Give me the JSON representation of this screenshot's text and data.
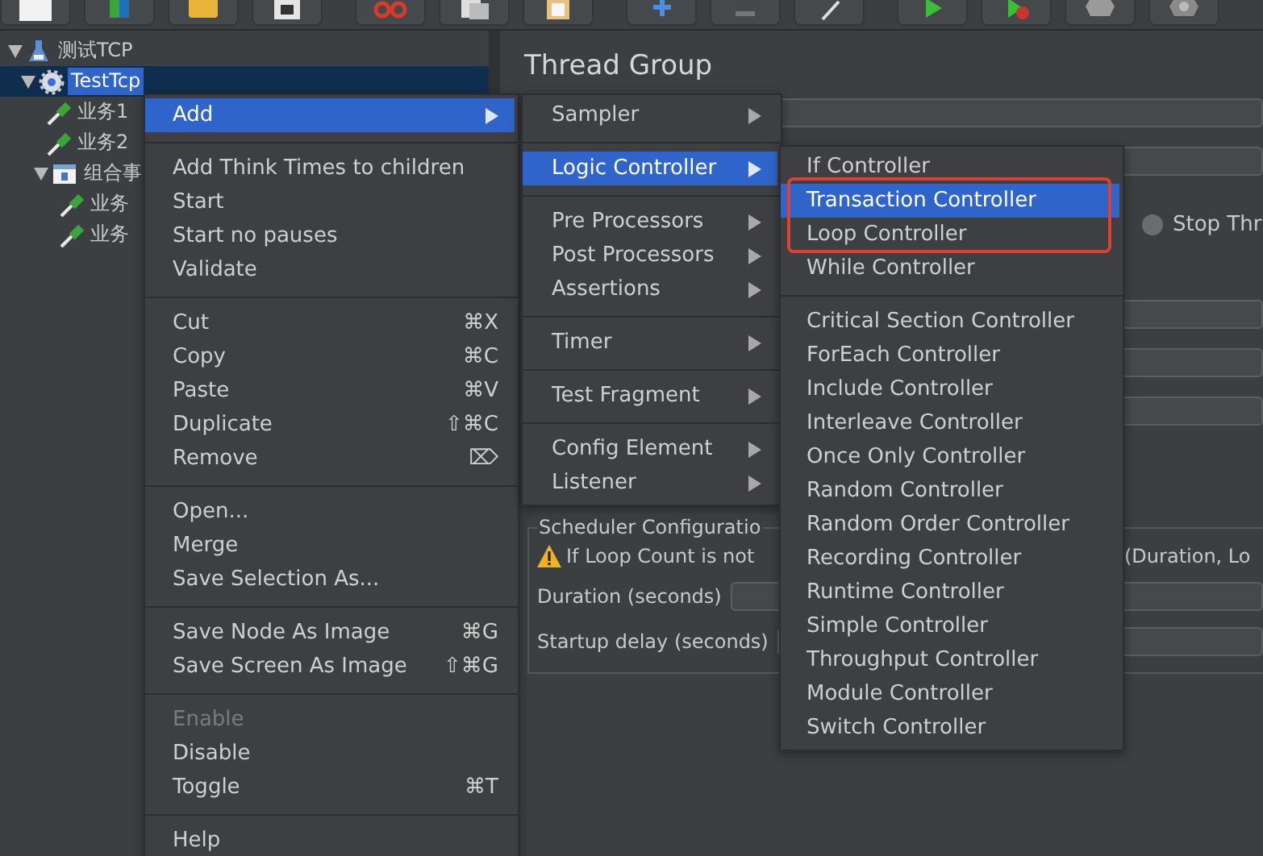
{
  "tree": [
    {
      "label": "测试TCP",
      "kind": "plan",
      "selected": false,
      "expanded": true,
      "children": [
        {
          "label": "TestTcp",
          "kind": "group",
          "selected": true,
          "expanded": true,
          "children": [
            {
              "label": "业务1",
              "kind": "sampler",
              "selected": false
            },
            {
              "label": "业务2",
              "kind": "sampler",
              "selected": false
            },
            {
              "label": "组合事",
              "kind": "controller",
              "selected": false,
              "expanded": true,
              "children": [
                {
                  "label": "业务",
                  "kind": "sampler",
                  "selected": false
                },
                {
                  "label": "业务",
                  "kind": "sampler",
                  "selected": false
                }
              ]
            }
          ]
        }
      ]
    }
  ],
  "panel": {
    "title": "Thread Group",
    "radio": {
      "label": "Stop Thr",
      "selected": false
    },
    "scheduler": {
      "title": "Scheduler Configuratio",
      "warning": "If Loop Count is not",
      "warning_tail": "(Duration, Lo",
      "fields": [
        {
          "label": "Duration (seconds)"
        },
        {
          "label": "Startup delay (seconds)"
        }
      ]
    }
  },
  "context_menu": {
    "sections": [
      {
        "items": [
          {
            "label": "Add",
            "submenu": true,
            "selected": true,
            "disabled": false
          }
        ]
      },
      {
        "items": [
          {
            "label": "Add Think Times to children",
            "submenu": false,
            "selected": false,
            "disabled": false
          },
          {
            "label": "Start",
            "submenu": false,
            "selected": false,
            "disabled": false
          },
          {
            "label": "Start no pauses",
            "submenu": false,
            "selected": false,
            "disabled": false
          },
          {
            "label": "Validate",
            "submenu": false,
            "selected": false,
            "disabled": false
          }
        ]
      },
      {
        "items": [
          {
            "label": "Cut",
            "shortcut": "⌘X",
            "submenu": false,
            "selected": false,
            "disabled": false
          },
          {
            "label": "Copy",
            "shortcut": "⌘C",
            "submenu": false,
            "selected": false,
            "disabled": false
          },
          {
            "label": "Paste",
            "shortcut": "⌘V",
            "submenu": false,
            "selected": false,
            "disabled": false
          },
          {
            "label": "Duplicate",
            "shortcut": "⇧⌘C",
            "submenu": false,
            "selected": false,
            "disabled": false
          },
          {
            "label": "Remove",
            "shortcut": "⌦",
            "submenu": false,
            "selected": false,
            "disabled": false
          }
        ]
      },
      {
        "items": [
          {
            "label": "Open...",
            "submenu": false,
            "selected": false,
            "disabled": false
          },
          {
            "label": "Merge",
            "submenu": false,
            "selected": false,
            "disabled": false
          },
          {
            "label": "Save Selection As...",
            "submenu": false,
            "selected": false,
            "disabled": false
          }
        ]
      },
      {
        "items": [
          {
            "label": "Save Node As Image",
            "shortcut": "⌘G",
            "submenu": false,
            "selected": false,
            "disabled": false
          },
          {
            "label": "Save Screen As Image",
            "shortcut": "⇧⌘G",
            "submenu": false,
            "selected": false,
            "disabled": false
          }
        ]
      },
      {
        "items": [
          {
            "label": "Enable",
            "submenu": false,
            "selected": false,
            "disabled": true
          },
          {
            "label": "Disable",
            "submenu": false,
            "selected": false,
            "disabled": false
          },
          {
            "label": "Toggle",
            "shortcut": "⌘T",
            "submenu": false,
            "selected": false,
            "disabled": false
          }
        ]
      },
      {
        "items": [
          {
            "label": "Help",
            "submenu": false,
            "selected": false,
            "disabled": false
          }
        ]
      }
    ]
  },
  "add_menu": {
    "sections": [
      {
        "items": [
          {
            "label": "Sampler",
            "submenu": true,
            "selected": false
          }
        ]
      },
      {
        "items": [
          {
            "label": "Logic Controller",
            "submenu": true,
            "selected": true
          }
        ]
      },
      {
        "items": [
          {
            "label": "Pre Processors",
            "submenu": true,
            "selected": false
          },
          {
            "label": "Post Processors",
            "submenu": true,
            "selected": false
          },
          {
            "label": "Assertions",
            "submenu": true,
            "selected": false
          }
        ]
      },
      {
        "items": [
          {
            "label": "Timer",
            "submenu": true,
            "selected": false
          }
        ]
      },
      {
        "items": [
          {
            "label": "Test Fragment",
            "submenu": true,
            "selected": false
          }
        ]
      },
      {
        "items": [
          {
            "label": "Config Element",
            "submenu": true,
            "selected": false
          },
          {
            "label": "Listener",
            "submenu": true,
            "selected": false
          }
        ]
      }
    ]
  },
  "controller_menu": {
    "sections": [
      {
        "items": [
          {
            "label": "If Controller",
            "selected": false,
            "outlined": false
          },
          {
            "label": "Transaction Controller",
            "selected": true,
            "outlined": true
          },
          {
            "label": "Loop Controller",
            "selected": false,
            "outlined": true
          },
          {
            "label": "While Controller",
            "selected": false,
            "outlined": false
          }
        ]
      },
      {
        "items": [
          {
            "label": "Critical Section Controller",
            "selected": false,
            "outlined": false
          },
          {
            "label": "ForEach Controller",
            "selected": false,
            "outlined": false
          },
          {
            "label": "Include Controller",
            "selected": false,
            "outlined": false
          },
          {
            "label": "Interleave Controller",
            "selected": false,
            "outlined": false
          },
          {
            "label": "Once Only Controller",
            "selected": false,
            "outlined": false
          },
          {
            "label": "Random Controller",
            "selected": false,
            "outlined": false
          },
          {
            "label": "Random Order Controller",
            "selected": false,
            "outlined": false
          },
          {
            "label": "Recording Controller",
            "selected": false,
            "outlined": false
          },
          {
            "label": "Runtime Controller",
            "selected": false,
            "outlined": false
          },
          {
            "label": "Simple Controller",
            "selected": false,
            "outlined": false
          },
          {
            "label": "Throughput Controller",
            "selected": false,
            "outlined": false
          },
          {
            "label": "Module Controller",
            "selected": false,
            "outlined": false
          },
          {
            "label": "Switch Controller",
            "selected": false,
            "outlined": false
          }
        ]
      }
    ]
  }
}
